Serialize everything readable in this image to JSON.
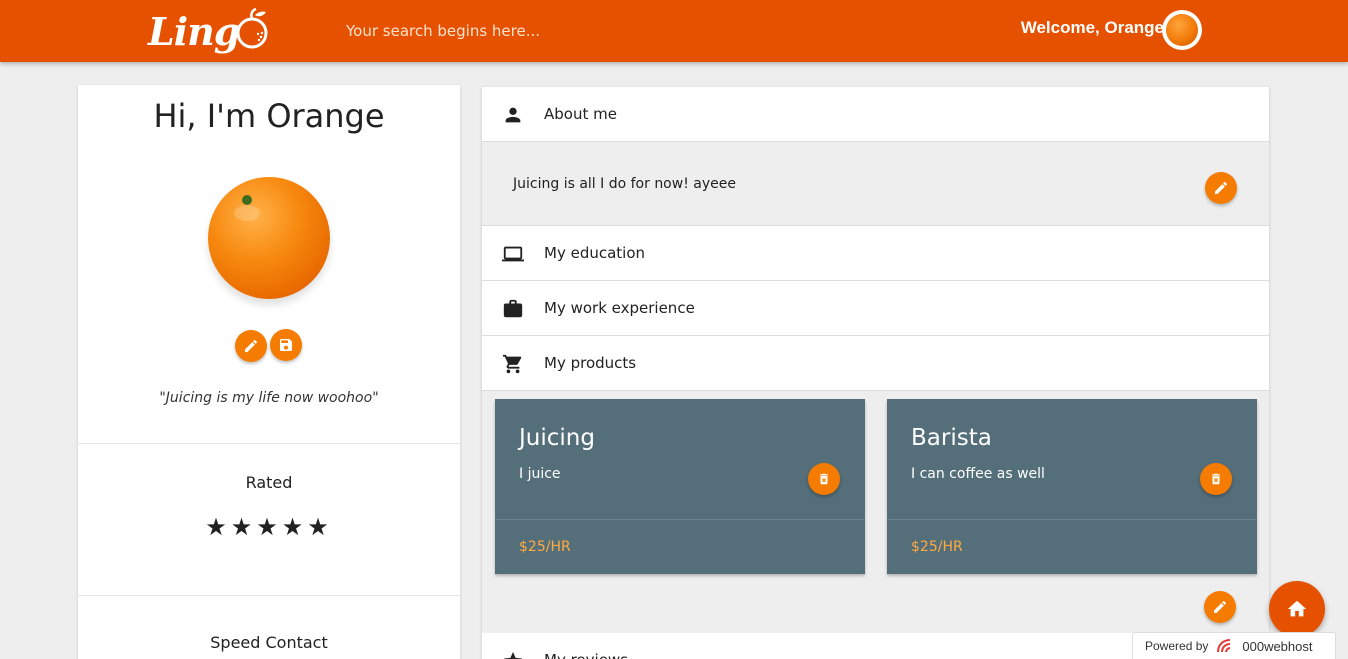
{
  "header": {
    "logo_text": "Ling",
    "search_placeholder": "Your search begins here...",
    "welcome": "Welcome, Orange",
    "colors": {
      "primary": "#e65100",
      "accent": "#f57c00"
    }
  },
  "profile": {
    "greeting": "Hi, I'm Orange",
    "quote": "\"Juicing is my life now woohoo\"",
    "rated_label": "Rated",
    "stars": "★★★★★",
    "rating": 5,
    "rating_max": 5,
    "speed_contact_label": "Speed Contact"
  },
  "sections": {
    "about": {
      "label": "About me",
      "icon": "person-icon",
      "text": "Juicing is all I do for now! ayeee"
    },
    "education": {
      "label": "My education",
      "icon": "laptop-icon"
    },
    "work": {
      "label": "My work experience",
      "icon": "briefcase-icon"
    },
    "products": {
      "label": "My products",
      "icon": "cart-icon",
      "items": [
        {
          "title": "Juicing",
          "description": "I juice",
          "price": "$25/HR"
        },
        {
          "title": "Barista",
          "description": "I can coffee as well",
          "price": "$25/HR"
        }
      ]
    },
    "reviews": {
      "label": "My reviews",
      "icon": "star-icon"
    }
  },
  "footer": {
    "powered_by": "Powered by",
    "host_brand": "000webhost"
  }
}
